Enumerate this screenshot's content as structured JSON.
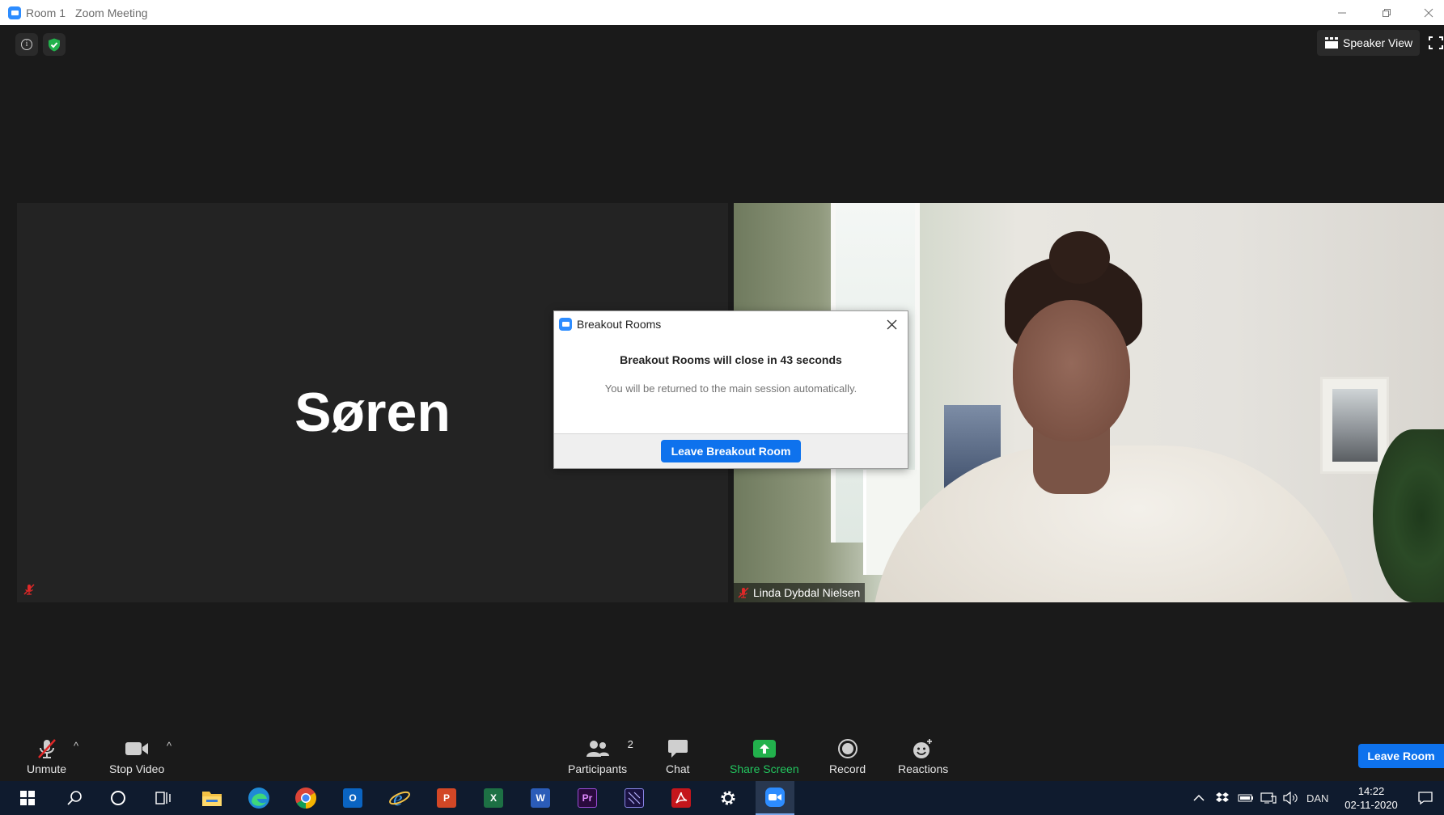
{
  "window": {
    "title_room": "Room 1",
    "title_app": "Zoom Meeting"
  },
  "top_controls": {
    "speaker_view_label": "Speaker View"
  },
  "participants_video": [
    {
      "name": "Søren",
      "video_on": false,
      "muted": true
    },
    {
      "name": "Linda Dybdal Nielsen",
      "video_on": true,
      "muted": true
    }
  ],
  "dialog": {
    "title": "Breakout Rooms",
    "heading": "Breakout Rooms will close in 43 seconds",
    "message": "You will be returned to the main session automatically.",
    "button_label": "Leave Breakout Room"
  },
  "toolbar": {
    "unmute_label": "Unmute",
    "stop_video_label": "Stop Video",
    "participants_label": "Participants",
    "participants_count": "2",
    "chat_label": "Chat",
    "share_screen_label": "Share Screen",
    "record_label": "Record",
    "reactions_label": "Reactions",
    "leave_room_label": "Leave Room"
  },
  "taskbar": {
    "apps": [
      "start",
      "search",
      "cortana",
      "task-view",
      "file-explorer",
      "edge",
      "chrome",
      "outlook",
      "internet-explorer",
      "powerpoint",
      "excel",
      "word",
      "premiere",
      "media-encoder",
      "acrobat",
      "settings",
      "zoom"
    ],
    "language": "DAN",
    "time": "14:22",
    "date": "02-11-2020"
  },
  "colors": {
    "accent_blue": "#0e72ed",
    "zoom_blue": "#2d8cff",
    "share_green": "#22b14c",
    "muted_red": "#e02828",
    "meeting_bg": "#1a1a1a",
    "taskbar_bg": "#0f1b2e"
  }
}
